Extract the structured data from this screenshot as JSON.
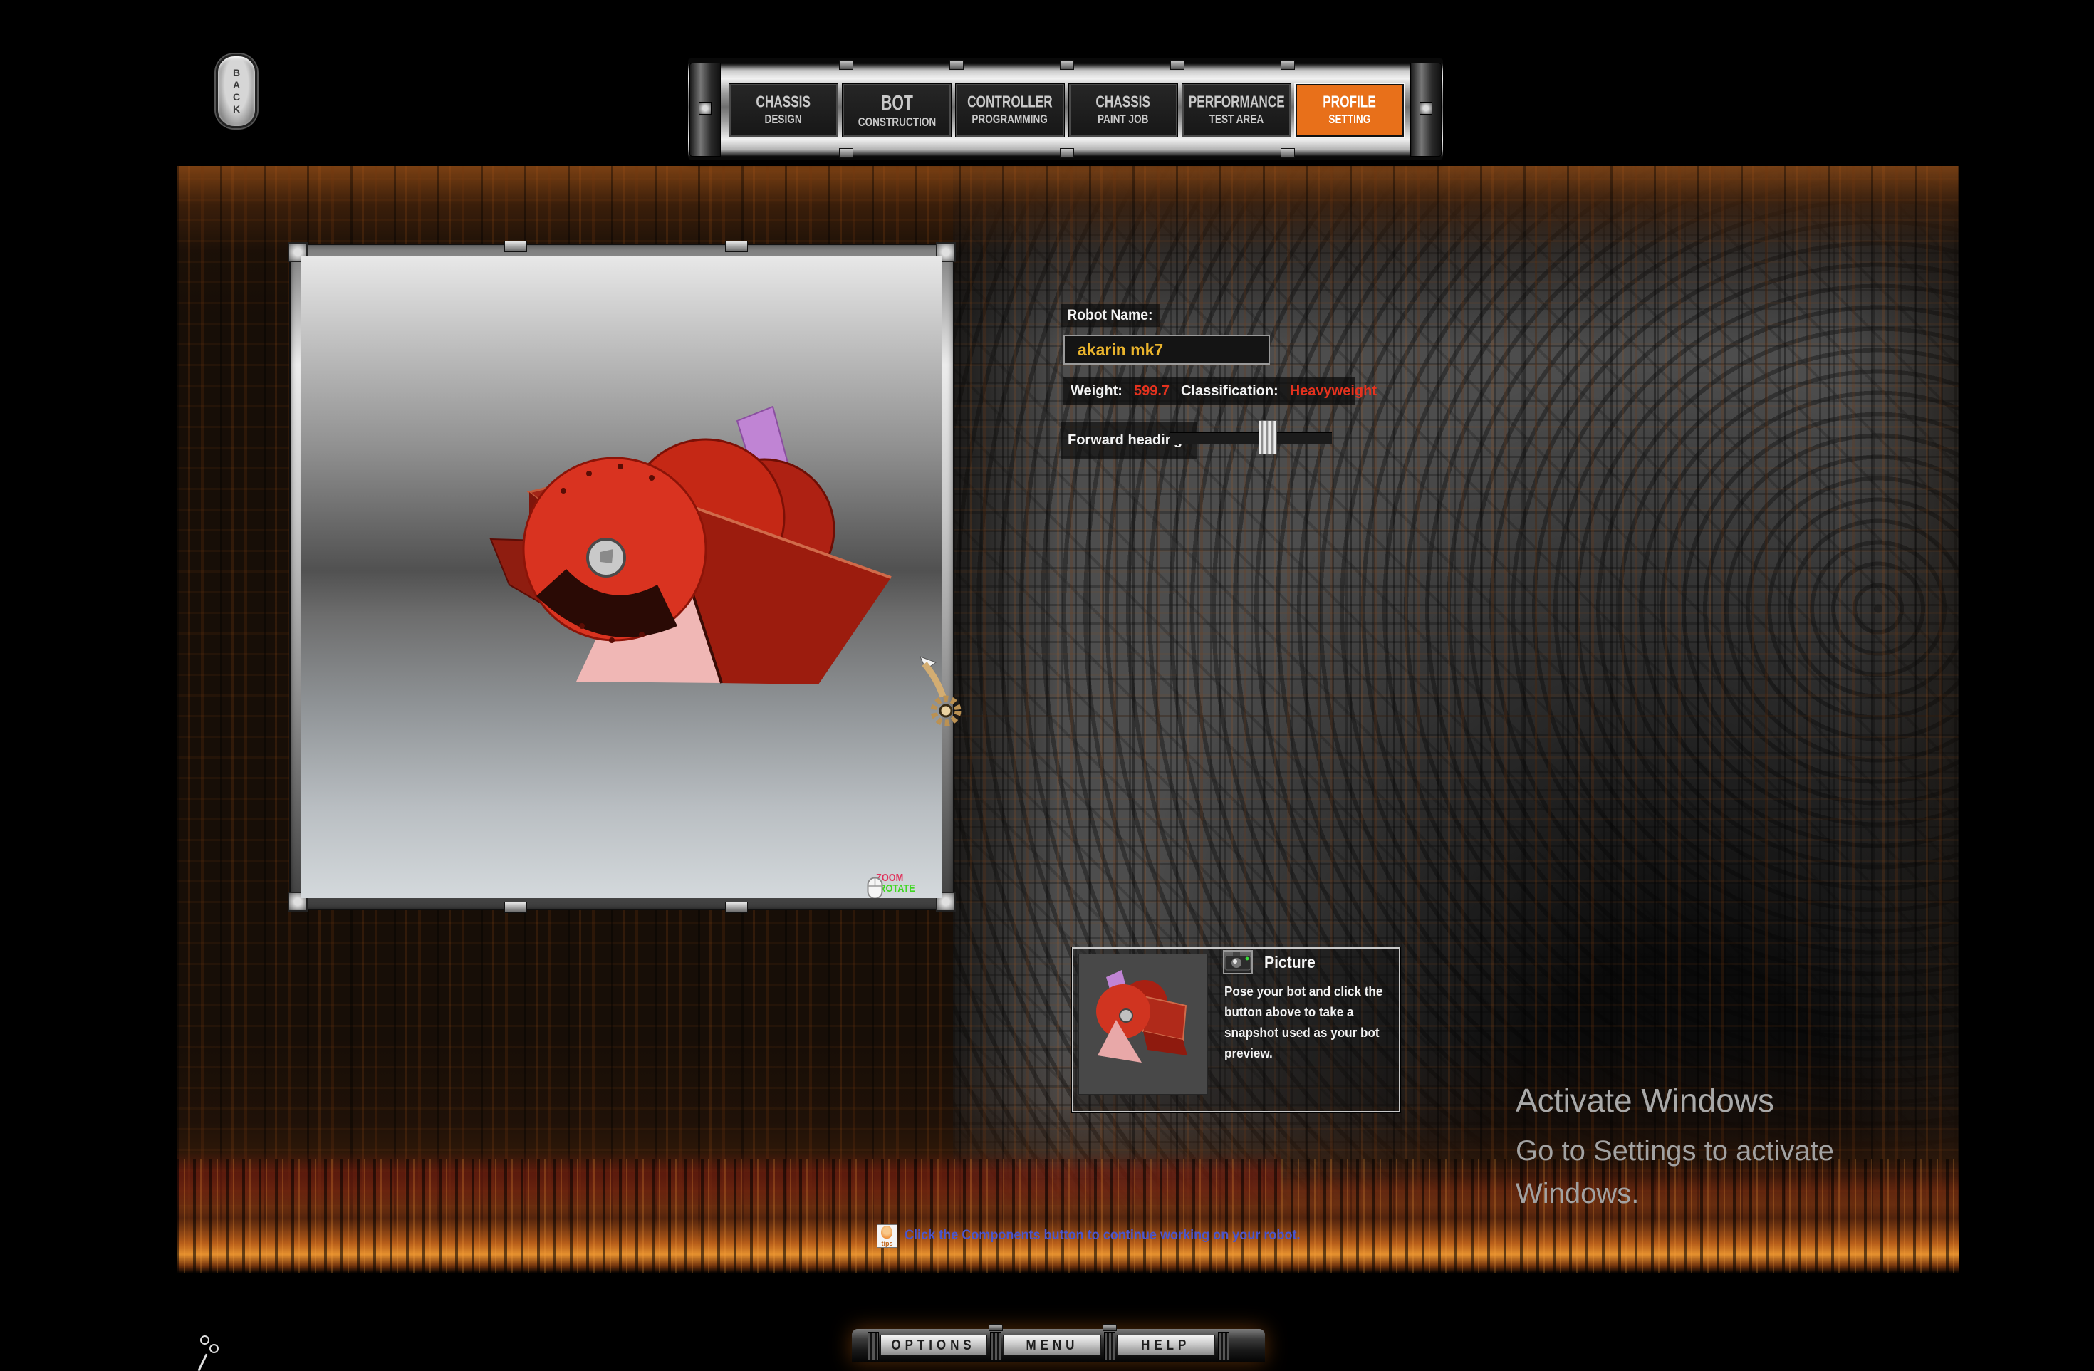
{
  "header": {
    "back_label": "BACK",
    "tabs": [
      {
        "line1": "CHASSIS",
        "line2": "DESIGN"
      },
      {
        "line1": "BOT",
        "line2": "CONSTRUCTION"
      },
      {
        "line1": "CONTROLLER",
        "line2": "PROGRAMMING"
      },
      {
        "line1": "CHASSIS",
        "line2": "PAINT JOB"
      },
      {
        "line1": "PERFORMANCE",
        "line2": "TEST AREA"
      },
      {
        "line1": "PROFILE",
        "line2": "SETTING"
      }
    ],
    "active_tab": "PROFILE SETTING"
  },
  "viewport": {
    "legend": {
      "zoom_label": "ZOOM",
      "rotate_label": "-ROTATE"
    }
  },
  "profile": {
    "robot_name_label": "Robot Name:",
    "robot_name_value": "akarin mk7",
    "weight_label": "Weight:",
    "weight_value": "599.7",
    "classification_label": "Classification:",
    "classification_value": "Heavyweight",
    "forward_heading_label": "Forward heading:"
  },
  "picture": {
    "title": "Picture",
    "body_lines": [
      "Pose your bot and click the",
      "button above to take a",
      "snapshot used as your bot",
      "preview."
    ]
  },
  "watermark": {
    "title": "Activate Windows",
    "line1": "Go to Settings to activate",
    "line2": "Windows."
  },
  "statusbar": {
    "tips_label": "tips",
    "message": "Click the Components button to continue working on your robot."
  },
  "footer": {
    "buttons": [
      "OPTIONS",
      "MENU",
      "HELP"
    ]
  },
  "colors": {
    "active_tab_orange": "#e8701a",
    "robot_name_gold": "#eab42c",
    "value_red": "#e5321e",
    "tip_blue": "#4a55cc",
    "legend_zoom_red": "#e0305a",
    "legend_rotate_green": "#3ed621"
  }
}
